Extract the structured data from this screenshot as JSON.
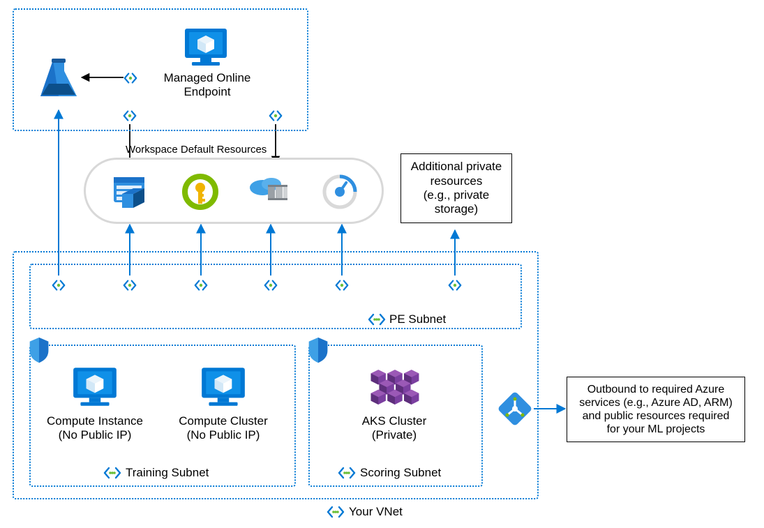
{
  "top": {
    "managed_online_endpoint": "Managed Online\nEndpoint"
  },
  "workspace_resources_label": "Workspace Default Resources",
  "additional_private": "Additional private\nresources\n(e.g., private\nstorage)",
  "outbound": "Outbound to required Azure\nservices (e.g., Azure AD, ARM)\nand public resources required\nfor your ML projects",
  "vnet": {
    "pe_subnet_label": "PE Subnet",
    "training_subnet_label": "Training Subnet",
    "scoring_subnet_label": "Scoring Subnet",
    "vnet_label": "Your VNet",
    "compute_instance": "Compute Instance\n(No Public IP)",
    "compute_cluster": "Compute Cluster\n(No Public IP)",
    "aks_cluster": "AKS Cluster\n(Private)"
  },
  "icons": {
    "ml_workspace": "azure-ml-icon",
    "monitor_endpoint": "monitor-icon",
    "storage": "storage-icon",
    "keyvault": "keyvault-icon",
    "container_registry": "container-registry-icon",
    "app_insights": "app-insights-icon",
    "private_link": "private-endpoint-icon",
    "hcm": "horizontal-connector-icon",
    "compute": "compute-monitor-icon",
    "aks": "aks-cluster-icon",
    "shield": "shield-icon",
    "load_balancer": "load-balancer-icon"
  }
}
